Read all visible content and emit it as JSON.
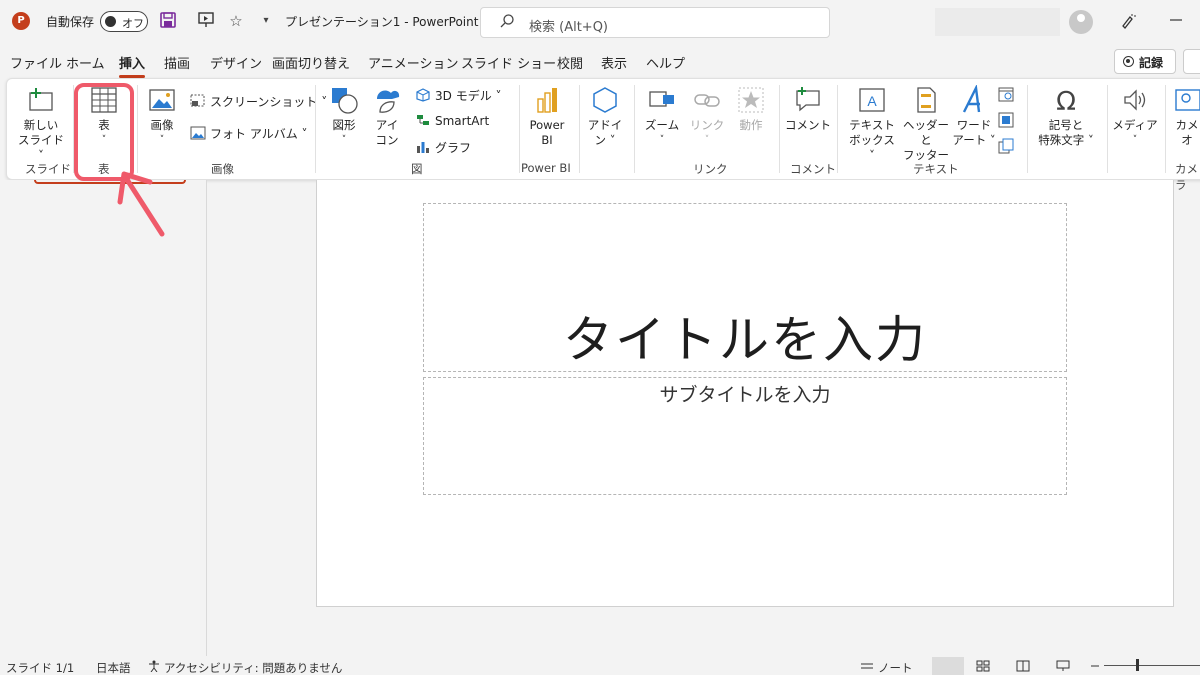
{
  "titlebar": {
    "autosave_label": "自動保存",
    "autosave_state": "オフ",
    "doc_title": "プレゼンテーション1  -  PowerPoint",
    "search_placeholder": "検索 (Alt+Q)"
  },
  "tabs": [
    "ファイル",
    "ホーム",
    "挿入",
    "描画",
    "デザイン",
    "画面切り替え",
    "アニメーション",
    "スライド ショー",
    "校閲",
    "表示",
    "ヘルプ"
  ],
  "active_tab": "挿入",
  "record_label": "記録",
  "ribbon": {
    "new_slide": [
      "新しい",
      "スライド ˅"
    ],
    "table": [
      "表",
      "˅"
    ],
    "image": [
      "画像",
      "˅"
    ],
    "screenshot": "スクリーンショット ˅",
    "photo_album": "フォト アルバム ˅",
    "shapes": [
      "図形",
      "˅"
    ],
    "icons": [
      "アイ",
      "コン"
    ],
    "model3d": "3D モデル  ˅",
    "smartart": "SmartArt",
    "graph": "グラフ",
    "powerbi": [
      "Power",
      "BI"
    ],
    "addin": [
      "アドイ",
      "ン ˅"
    ],
    "zoom": [
      "ズーム",
      "˅"
    ],
    "link": [
      "リンク",
      "˅"
    ],
    "action": "動作",
    "comment": "コメント",
    "textbox": [
      "テキスト",
      "ボックス ˅"
    ],
    "header_footer": [
      "ヘッダーと",
      "フッター"
    ],
    "wordart": [
      "ワード",
      "アート ˅"
    ],
    "symbols": [
      "記号と",
      "特殊文字 ˅"
    ],
    "media": [
      "メディア",
      "˅"
    ],
    "camera": [
      "カメ",
      "オ"
    ],
    "groups": {
      "slide": "スライド",
      "table": "表",
      "image": "画像",
      "figure": "図",
      "powerbi": "Power BI",
      "link": "リンク",
      "comment": "コメント",
      "text": "テキスト",
      "camera": "カメラ"
    }
  },
  "slide": {
    "title_placeholder": "タイトルを入力",
    "subtitle_placeholder": "サブタイトルを入力"
  },
  "status": {
    "slide_count": "スライド 1/1",
    "language": "日本語",
    "accessibility": "アクセシビリティ: 問題ありません",
    "notes": "ノート"
  },
  "colors": {
    "accent": "#c43e1c",
    "highlight": "#ef5a6a"
  }
}
